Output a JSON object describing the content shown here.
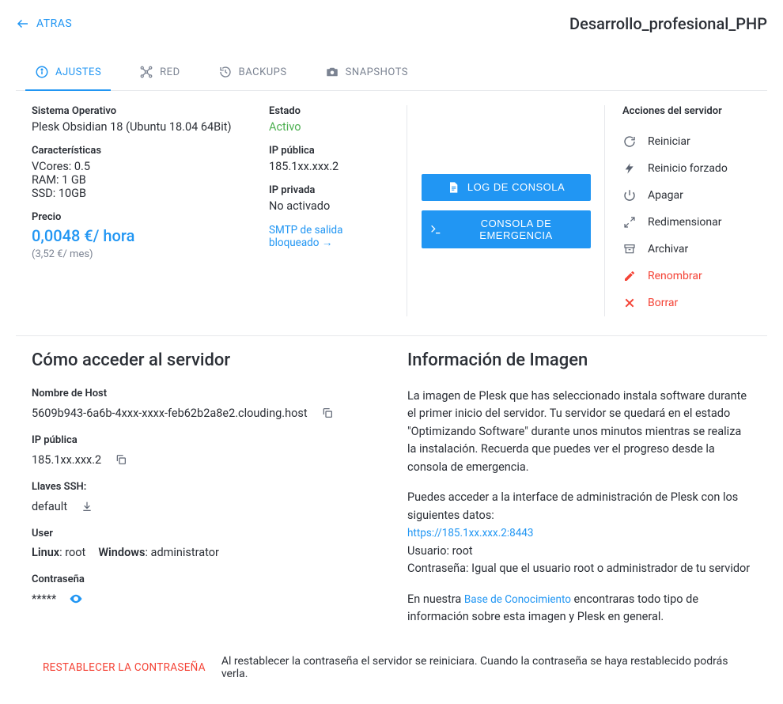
{
  "header": {
    "back": "ATRAS",
    "title": "Desarrollo_profesional_PHP"
  },
  "tabs": {
    "settings": "AJUSTES",
    "network": "RED",
    "backups": "BACKUPS",
    "snapshots": "SNAPSHOTS"
  },
  "overview": {
    "os_label": "Sistema Operativo",
    "os_value": "Plesk Obsidian 18 (Ubuntu 18.04 64Bit)",
    "specs_label": "Características",
    "specs_vcores": "VCores: 0.5",
    "specs_ram": "RAM: 1 GB",
    "specs_ssd": "SSD: 10GB",
    "price_label": "Precio",
    "price_value": "0,0048 €/ hora",
    "price_month": "(3,52 €/ mes)",
    "state_label": "Estado",
    "state_value": "Activo",
    "ippub_label": "IP pública",
    "ippub_value": "185.1xx.xxx.2",
    "ippriv_label": "IP privada",
    "ippriv_value": "No activado",
    "smtp": "SMTP de salida bloqueado →"
  },
  "buttons": {
    "console_log": "LOG DE CONSOLA",
    "emergency": "CONSOLA DE EMERGENCIA"
  },
  "actions": {
    "header": "Acciones del servidor",
    "restart": "Reiniciar",
    "force_restart": "Reinicio forzado",
    "shutdown": "Apagar",
    "resize": "Redimensionar",
    "archive": "Archivar",
    "rename": "Renombrar",
    "delete": "Borrar"
  },
  "access": {
    "heading": "Cómo acceder al servidor",
    "host_label": "Nombre de Host",
    "host_value": "5609b943-6a6b-4xxx-xxxx-feb62b2a8e2.clouding.host",
    "ippub_label": "IP pública",
    "ippub_value": "185.1xx.xxx.2",
    "ssh_label": "Llaves SSH:",
    "ssh_value": "default",
    "user_label": "User",
    "user_linux_key": "Linux",
    "user_linux_val": ": root",
    "user_win_key": "Windows",
    "user_win_val": ": administrator",
    "pwd_label": "Contraseña",
    "pwd_value": "*****"
  },
  "image_info": {
    "heading": "Información de Imagen",
    "p1": "La imagen de Plesk que has seleccionado instala software durante el primer inicio del servidor. Tu servidor se quedará en el estado \"Optimizando Software\" durante unos minutos mientras se realiza la instalación. Recuerda que puedes ver el progreso desde la consola de emergencia.",
    "p2a": "Puedes acceder a la interface de administración de Plesk con los siguientes datos:",
    "admin_url": "https://185.1xx.xxx.2:8443",
    "admin_user": "Usuario: root",
    "admin_pwd": "Contraseña: Igual que el usuario root o administrador de tu servidor",
    "p3a": "En nuestra ",
    "p3link": "Base de Conocimiento",
    "p3b": " encontraras todo tipo de información sobre esta imagen y Plesk en general."
  },
  "reset": {
    "button": "RESTABLECER LA CONTRASEÑA",
    "text": "Al restablecer la contraseña el servidor se reiniciara. Cuando la contraseña se haya restablecido podrás verla."
  }
}
